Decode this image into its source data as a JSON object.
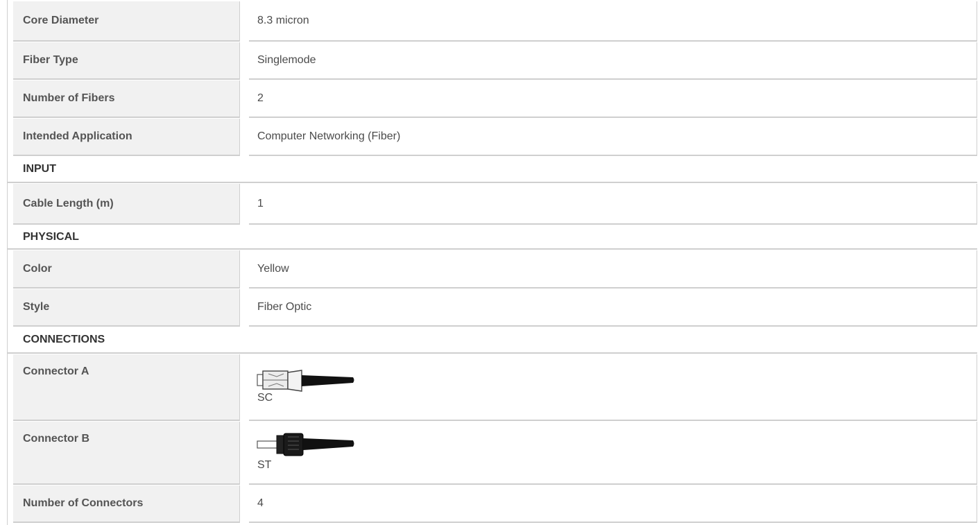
{
  "rows": [
    {
      "label": "Core Diameter",
      "value": "8.3 micron"
    },
    {
      "label": "Fiber Type",
      "value": "Singlemode"
    },
    {
      "label": "Number of Fibers",
      "value": "2"
    },
    {
      "label": "Intended Application",
      "value": "Computer Networking (Fiber)"
    }
  ],
  "sections": {
    "input": {
      "title": "INPUT",
      "rows": [
        {
          "label": "Cable Length (m)",
          "value": "1"
        }
      ]
    },
    "physical": {
      "title": "PHYSICAL",
      "rows": [
        {
          "label": "Color",
          "value": "Yellow"
        },
        {
          "label": "Style",
          "value": "Fiber Optic"
        }
      ]
    },
    "connections": {
      "title": "CONNECTIONS",
      "rows": [
        {
          "label": "Connector A",
          "caption": "SC",
          "icon": "sc-connector-icon"
        },
        {
          "label": "Connector B",
          "caption": "ST",
          "icon": "st-connector-icon"
        },
        {
          "label": "Number of Connectors",
          "value": "4"
        }
      ]
    }
  },
  "colors": {
    "label_bg": "#f1f1f1",
    "border": "#cfcfcf",
    "text": "#4b4b4b"
  }
}
